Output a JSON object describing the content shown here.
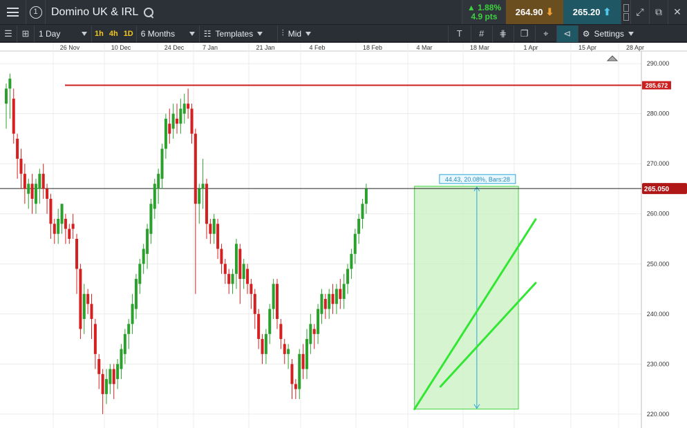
{
  "topbar": {
    "layout_number": "1",
    "instrument_name": "Domino UK & IRL",
    "change_percent": "1.88%",
    "change_points": "4.9 pts",
    "sell_price": "264.90",
    "buy_price": "265.20"
  },
  "toolbar": {
    "interval": "1 Day",
    "timeframes": [
      "1h",
      "4h",
      "1D"
    ],
    "period": "6 Months",
    "templates_label": "Templates",
    "price_type": "Mid",
    "settings_label": "Settings"
  },
  "icons": [
    "menu-icon",
    "layout-icon",
    "search-icon",
    "up-arrow-icon",
    "down-arrow-icon",
    "expand-icon",
    "popout-icon",
    "close-icon",
    "list-icon",
    "grid-icon",
    "templates-icon",
    "candles-icon",
    "text-tool-icon",
    "hashtag-icon",
    "fib-icon",
    "layers-icon",
    "crosshair-icon",
    "eraser-icon",
    "gear-icon"
  ],
  "colors": {
    "up": "#2ca02c",
    "down": "#d42020",
    "horizontal_line": "#cc1f1f",
    "trendline": "#33e633",
    "measure_fill": "#c8f0c0",
    "measure_border": "#3bd43b",
    "measure_arrow": "#2aa6d8",
    "current_price_label": "#b01818"
  },
  "chart_data": {
    "type": "candlestick",
    "x_ticks": [
      "26 Nov",
      "10 Dec",
      "24 Dec",
      "7 Jan",
      "21 Jan",
      "4 Feb",
      "18 Feb",
      "4 Mar",
      "18 Mar",
      "1 Apr",
      "15 Apr",
      "28 Apr"
    ],
    "y_ticks": [
      "290.000",
      "280.000",
      "270.000",
      "260.000",
      "250.000",
      "240.000",
      "230.000",
      "220.000"
    ],
    "ylim": [
      217.5,
      292.5
    ],
    "horizontal_line_label": "285.672",
    "horizontal_line_value": 285.672,
    "current_price_label": "265.050",
    "current_price_value": 265.05,
    "measure_label": "44.43, 20.08%, Bars:28",
    "measure_range": {
      "from_bar": 110,
      "to_bar": 138,
      "low": 221.0,
      "high": 265.5
    },
    "trendlines": [
      {
        "from": {
          "bar": 110,
          "price": 221.0
        },
        "to": {
          "bar": 146,
          "price": 258.9
        }
      },
      {
        "from": {
          "bar": 117,
          "price": 225.5
        },
        "to": {
          "bar": 146,
          "price": 246.2
        }
      }
    ],
    "candles": [
      [
        282,
        285,
        278,
        286,
        277
      ],
      [
        285,
        287,
        280,
        288,
        279
      ],
      [
        283,
        276,
        275,
        285,
        274
      ],
      [
        275,
        271,
        268,
        276,
        267
      ],
      [
        271,
        268,
        266,
        273,
        265
      ],
      [
        268,
        265,
        264,
        270,
        262
      ],
      [
        264,
        266,
        262,
        267,
        261
      ],
      [
        266,
        263,
        261,
        268,
        260
      ],
      [
        262,
        266,
        261,
        267,
        260
      ],
      [
        265,
        268,
        264,
        269,
        262
      ],
      [
        268,
        265,
        264,
        270,
        263
      ],
      [
        265,
        263,
        261,
        266,
        260
      ],
      [
        263,
        258,
        256,
        264,
        255
      ],
      [
        258,
        256,
        254,
        259,
        254
      ],
      [
        256,
        259,
        255,
        261,
        254
      ],
      [
        258,
        262,
        256,
        262,
        256
      ],
      [
        259,
        257,
        256,
        260,
        254
      ],
      [
        257,
        255,
        254,
        258,
        254
      ],
      [
        258,
        257,
        256,
        260,
        255
      ],
      [
        255,
        249,
        245,
        256,
        244
      ],
      [
        249,
        237,
        236,
        250,
        235
      ],
      [
        239,
        244,
        237,
        246,
        236
      ],
      [
        244,
        242,
        241,
        245,
        240
      ],
      [
        242,
        239,
        237,
        244,
        235
      ],
      [
        238,
        232,
        231,
        239,
        229
      ],
      [
        231,
        228,
        226,
        232,
        225
      ],
      [
        228,
        224,
        222,
        229,
        220
      ],
      [
        224,
        227,
        223,
        229,
        222
      ],
      [
        226,
        229,
        225,
        230,
        224
      ],
      [
        229,
        226,
        224,
        230,
        223
      ],
      [
        227,
        230,
        226,
        231,
        225
      ],
      [
        229,
        233,
        228,
        234,
        227
      ],
      [
        232,
        236,
        231,
        237,
        230
      ],
      [
        236,
        238,
        234,
        239,
        233
      ],
      [
        238,
        242,
        237,
        244,
        236
      ],
      [
        241,
        247,
        240,
        248,
        239
      ],
      [
        246,
        250,
        245,
        251,
        244
      ],
      [
        250,
        253,
        249,
        254,
        248
      ],
      [
        252,
        257,
        250,
        258,
        249
      ],
      [
        256,
        262,
        255,
        263,
        254
      ],
      [
        261,
        266,
        260,
        267,
        259
      ],
      [
        265,
        268,
        263,
        269,
        262
      ],
      [
        267,
        273,
        266,
        274,
        265
      ],
      [
        273,
        279,
        272,
        280,
        271
      ],
      [
        278,
        276,
        275,
        281,
        274
      ],
      [
        277,
        280,
        276,
        282,
        275
      ],
      [
        279,
        278,
        277,
        282,
        276
      ],
      [
        278,
        281,
        277,
        283,
        276
      ],
      [
        280,
        282,
        279,
        284,
        278
      ],
      [
        282,
        281,
        280,
        285,
        279
      ],
      [
        281,
        276,
        275,
        282,
        274
      ],
      [
        276,
        262,
        250,
        277,
        244
      ],
      [
        262,
        265,
        260,
        266,
        258
      ],
      [
        265,
        266,
        262,
        271,
        261
      ],
      [
        266,
        258,
        257,
        267,
        255
      ],
      [
        258,
        256,
        255,
        259,
        254
      ],
      [
        256,
        259,
        255,
        260,
        254
      ],
      [
        258,
        253,
        252,
        259,
        251
      ],
      [
        253,
        250,
        249,
        254,
        248
      ],
      [
        250,
        248,
        247,
        251,
        246
      ],
      [
        248,
        246,
        245,
        249,
        244
      ],
      [
        246,
        248,
        245,
        249,
        244
      ],
      [
        248,
        254,
        246,
        255,
        245
      ],
      [
        253,
        247,
        243,
        254,
        242
      ],
      [
        247,
        250,
        246,
        251,
        245
      ],
      [
        249,
        246,
        245,
        250,
        244
      ],
      [
        246,
        244,
        242,
        247,
        241
      ],
      [
        244,
        240,
        238,
        245,
        237
      ],
      [
        240,
        235,
        234,
        241,
        233
      ],
      [
        235,
        232,
        231,
        236,
        230
      ],
      [
        232,
        236,
        231,
        237,
        230
      ],
      [
        236,
        241,
        235,
        242,
        234
      ],
      [
        241,
        246,
        240,
        247,
        239
      ],
      [
        246,
        239,
        238,
        247,
        237
      ],
      [
        238,
        235,
        234,
        239,
        233
      ],
      [
        234,
        232,
        231,
        235,
        230
      ],
      [
        232,
        233,
        230,
        234,
        229
      ],
      [
        230,
        226,
        225,
        231,
        223
      ],
      [
        226,
        225,
        224,
        227,
        223
      ],
      [
        225,
        232,
        224,
        233,
        223
      ],
      [
        232,
        229,
        228,
        234,
        227
      ],
      [
        229,
        235,
        228,
        237,
        227
      ],
      [
        234,
        238,
        233,
        240,
        232
      ],
      [
        237,
        236,
        234,
        238,
        233
      ],
      [
        236,
        241,
        235,
        242,
        234
      ],
      [
        240,
        244,
        239,
        245,
        238
      ],
      [
        243,
        241,
        240,
        244,
        239
      ],
      [
        241,
        244,
        240,
        245,
        239
      ],
      [
        244,
        242,
        241,
        246,
        240
      ],
      [
        242,
        245,
        241,
        246,
        240
      ],
      [
        245,
        243,
        242,
        247,
        241
      ],
      [
        243,
        246,
        242,
        248,
        241
      ],
      [
        246,
        249,
        245,
        250,
        244
      ],
      [
        249,
        252,
        248,
        253,
        247
      ],
      [
        252,
        256,
        251,
        257,
        250
      ],
      [
        256,
        259,
        255,
        260,
        254
      ],
      [
        259,
        262,
        258,
        263,
        257
      ],
      [
        262,
        265,
        261,
        266,
        260
      ]
    ]
  }
}
